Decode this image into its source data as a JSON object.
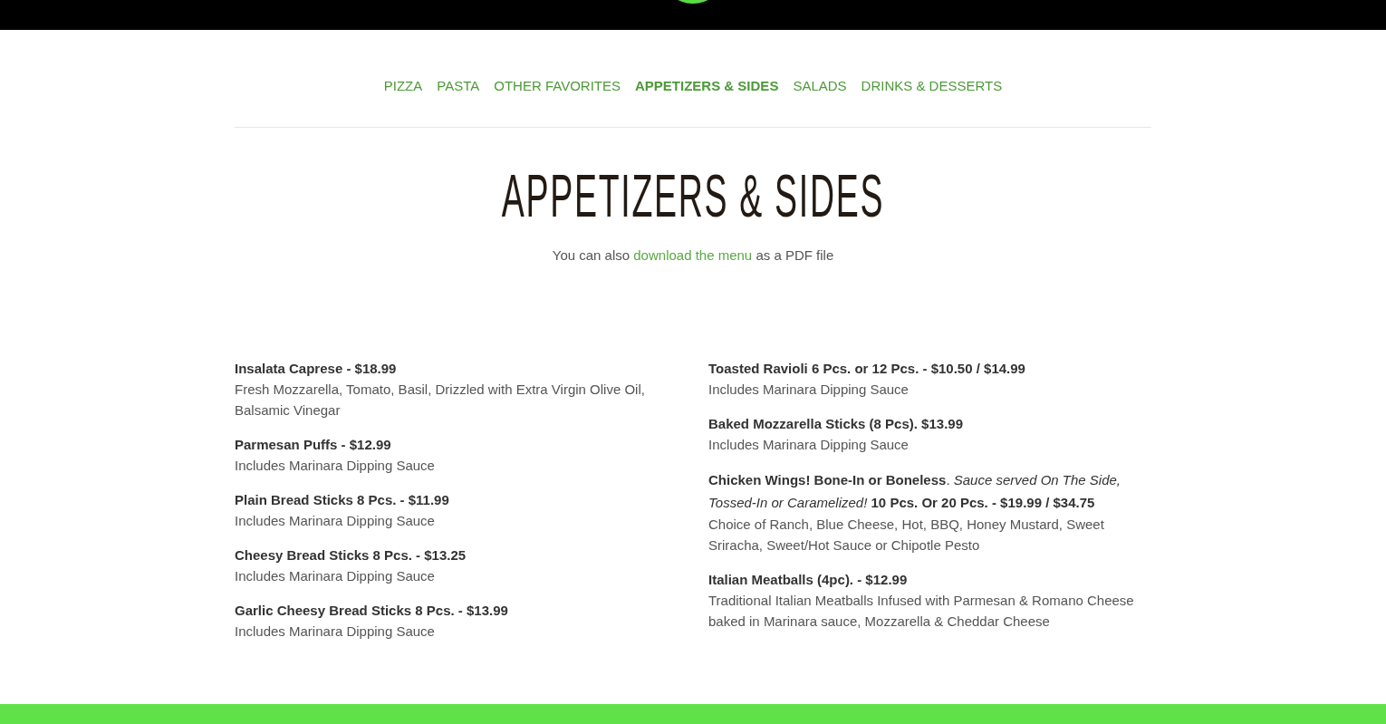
{
  "nav": {
    "items": [
      {
        "label": "PIZZA",
        "selected": false
      },
      {
        "label": "PASTA",
        "selected": false
      },
      {
        "label": "OTHER FAVORITES",
        "selected": false
      },
      {
        "label": "APPETIZERS & SIDES",
        "selected": true
      },
      {
        "label": "SALADS",
        "selected": false
      },
      {
        "label": "DRINKS & DESSERTS",
        "selected": false
      }
    ]
  },
  "page_title": "APPETIZERS & SIDES",
  "intro": {
    "before": "You can also",
    "link": "download the menu",
    "after": "as a PDF file"
  },
  "columns": [
    {
      "items": [
        {
          "kind": "plain",
          "title": "Insalata Caprese - $18.99",
          "description": "Fresh Mozzarella, Tomato, Basil, Drizzled with Extra Virgin Olive Oil, Balsamic Vinegar"
        },
        {
          "kind": "plain",
          "title": "Parmesan Puffs - $12.99",
          "description": "Includes Marinara Dipping Sauce"
        },
        {
          "kind": "plain",
          "title": "Plain Bread Sticks 8 Pcs. - $11.99",
          "description": "Includes Marinara Dipping Sauce"
        },
        {
          "kind": "plain",
          "title": "Cheesy Bread Sticks 8 Pcs. - $13.25",
          "description": "Includes Marinara Dipping Sauce"
        },
        {
          "kind": "plain",
          "title": "Garlic Cheesy Bread Sticks 8 Pcs. - $13.99",
          "description": "Includes Marinara Dipping Sauce"
        }
      ]
    },
    {
      "items": [
        {
          "kind": "plain",
          "title": "Toasted Ravioli 6 Pcs. or 12 Pcs. - $10.50 / $14.99",
          "description": "Includes Marinara Dipping Sauce"
        },
        {
          "kind": "plain",
          "title": "Baked Mozzarella Sticks (8 Pcs). $13.99",
          "description": "Includes Marinara Dipping Sauce"
        },
        {
          "kind": "mixed",
          "title": "**Chicken Wings! Bone-In or Boneless**. *Sauce served On The Side, Tossed-In or Caramelized!* **10 Pcs. Or 20 Pcs. - $19.99 / $34.75**",
          "description": "Choice of Ranch, Blue Cheese, Hot, BBQ, Honey Mustard, Sweet Sriracha, Sweet/Hot Sauce or Chipotle Pesto"
        },
        {
          "kind": "plain",
          "title": "Italian Meatballs (4pc). - $12.99",
          "description": "Traditional Italian Meatballs Infused with Parmesan & Romano Cheese baked in Marinara sauce, Mozzarella & Cheddar Cheese"
        }
      ]
    }
  ]
}
